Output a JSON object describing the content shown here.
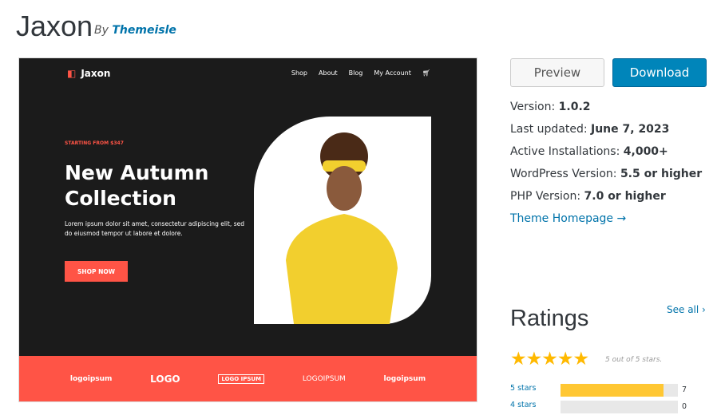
{
  "theme": {
    "name": "Jaxon",
    "by_prefix": "By",
    "author": "Themeisle"
  },
  "screenshot": {
    "logo": "Jaxon",
    "nav": [
      "Shop",
      "About",
      "Blog",
      "My Account"
    ],
    "kicker": "STARTING FROM $347",
    "hero": "New Autumn Collection",
    "lorem": "Lorem ipsum dolor sit amet, consectetur adipiscing elit, sed do eiusmod tempor ut labore et dolore.",
    "cta": "SHOP NOW",
    "logos": [
      "logoipsum",
      "LOGO",
      "LOGO IPSUM",
      "LOGOIPSUM",
      "logoipsum"
    ]
  },
  "actions": {
    "preview": "Preview",
    "download": "Download"
  },
  "meta": [
    {
      "label": "Version:",
      "value": "1.0.2"
    },
    {
      "label": "Last updated:",
      "value": "June 7, 2023"
    },
    {
      "label": "Active Installations:",
      "value": "4,000+"
    },
    {
      "label": "WordPress Version:",
      "value": "5.5 or higher"
    },
    {
      "label": "PHP Version:",
      "value": "7.0 or higher"
    }
  ],
  "homepage_link": "Theme Homepage →",
  "ratings": {
    "title": "Ratings",
    "see_all": "See all ›",
    "stars": "★★★★★",
    "summary": "5 out of 5 stars.",
    "rating": 5,
    "rows": [
      {
        "label": "5 stars",
        "count": "7",
        "fill": 0.88
      },
      {
        "label": "4 stars",
        "count": "0",
        "fill": 0
      }
    ]
  },
  "colors": {
    "accent": "#ff5446",
    "link": "#0073aa",
    "download": "#0085ba",
    "star": "#ffb900"
  }
}
